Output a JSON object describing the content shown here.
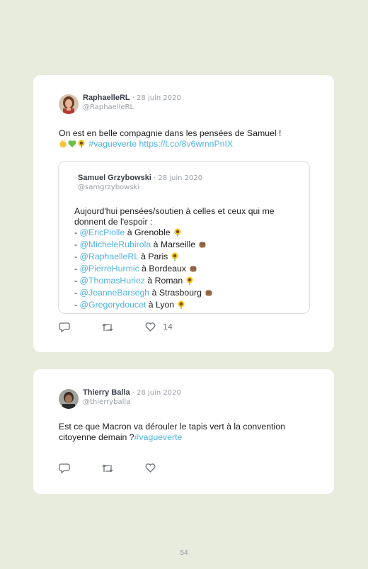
{
  "tweet1": {
    "name": "RaphaelleRL",
    "date": "· 28 juin 2020",
    "handle": "@RaphaelleRL",
    "text_line1": "On est en belle compagnie dans les pensées de Samuel !",
    "hashtag": "#vagueverte",
    "url": "https://t.co/8v6wmnPnIX",
    "likes": "14",
    "quoted": {
      "name": "Samuel Grzybowski",
      "date": "· 28 juin 2020",
      "handle": "@samgrzybowski",
      "intro_line1": "Aujourd'hui pensées/soutien à celles et ceux qui me",
      "intro_line2": "donnent de l'espoir :",
      "items": [
        {
          "mention": "@EricPiolle",
          "place": "à Grenoble",
          "emoji": "sunflower"
        },
        {
          "mention": "@MicheleRubirola",
          "place": "à Marseille",
          "emoji": "fist"
        },
        {
          "mention": "@RaphaelleRL",
          "place": "à Paris",
          "emoji": "sunflower"
        },
        {
          "mention": "@PierreHurmic",
          "place": "à Bordeaux",
          "emoji": "fist"
        },
        {
          "mention": "@ThomasHuriez",
          "place": "à Roman",
          "emoji": "sunflower"
        },
        {
          "mention": "@JeanneBarsegh",
          "place": "à Strasbourg",
          "emoji": "fist"
        },
        {
          "mention": "@Gregorydoucet",
          "place": "à Lyon",
          "emoji": "sunflower"
        }
      ]
    }
  },
  "tweet2": {
    "name": "Thierry Balla",
    "date": "· 28 juin 2020",
    "handle": "@thierryballa",
    "text_line1": "Est ce que Macron va dérouler le tapis vert à la convention",
    "text_line2": "citoyenne demain ?",
    "hashtag": "#vagueverte"
  },
  "page_number": "54",
  "icons": [
    "reply-icon",
    "retweet-icon",
    "like-icon",
    "sunflower-emoji",
    "fist-emoji",
    "clap-emoji",
    "green-heart-emoji"
  ],
  "colors": {
    "link": "#4fb3df",
    "background": "#e8ecdc",
    "card": "#ffffff"
  }
}
